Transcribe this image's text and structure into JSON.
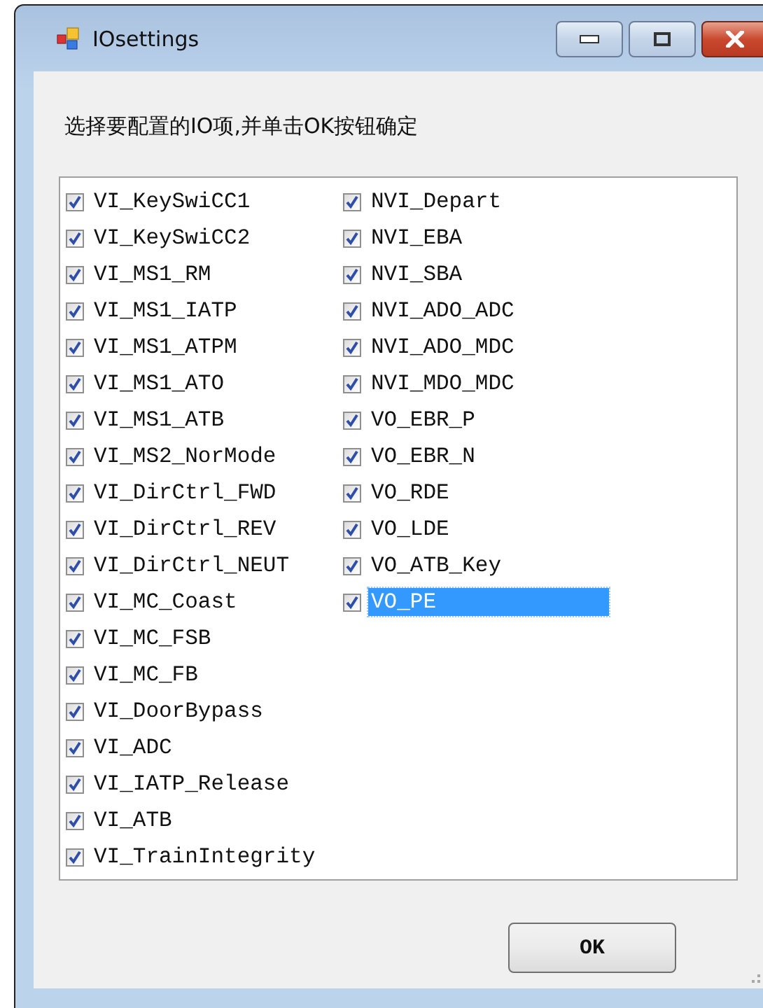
{
  "window": {
    "title": "IOsettings"
  },
  "instruction": "选择要配置的IO项,并单击OK按钮确定",
  "items": [
    {
      "label": "VI_KeySwiCC1",
      "checked": true,
      "selected": false
    },
    {
      "label": "VI_KeySwiCC2",
      "checked": true,
      "selected": false
    },
    {
      "label": "VI_MS1_RM",
      "checked": true,
      "selected": false
    },
    {
      "label": "VI_MS1_IATP",
      "checked": true,
      "selected": false
    },
    {
      "label": "VI_MS1_ATPM",
      "checked": true,
      "selected": false
    },
    {
      "label": "VI_MS1_ATO",
      "checked": true,
      "selected": false
    },
    {
      "label": "VI_MS1_ATB",
      "checked": true,
      "selected": false
    },
    {
      "label": "VI_MS2_NorMode",
      "checked": true,
      "selected": false
    },
    {
      "label": "VI_DirCtrl_FWD",
      "checked": true,
      "selected": false
    },
    {
      "label": "VI_DirCtrl_REV",
      "checked": true,
      "selected": false
    },
    {
      "label": "VI_DirCtrl_NEUT",
      "checked": true,
      "selected": false
    },
    {
      "label": "VI_MC_Coast",
      "checked": true,
      "selected": false
    },
    {
      "label": "VI_MC_FSB",
      "checked": true,
      "selected": false
    },
    {
      "label": "VI_MC_FB",
      "checked": true,
      "selected": false
    },
    {
      "label": "VI_DoorBypass",
      "checked": true,
      "selected": false
    },
    {
      "label": "VI_ADC",
      "checked": true,
      "selected": false
    },
    {
      "label": "VI_IATP_Release",
      "checked": true,
      "selected": false
    },
    {
      "label": "VI_ATB",
      "checked": true,
      "selected": false
    },
    {
      "label": "VI_TrainIntegrity",
      "checked": true,
      "selected": false
    },
    {
      "label": "NVI_Depart",
      "checked": true,
      "selected": false
    },
    {
      "label": "NVI_EBA",
      "checked": true,
      "selected": false
    },
    {
      "label": "NVI_SBA",
      "checked": true,
      "selected": false
    },
    {
      "label": "NVI_ADO_ADC",
      "checked": true,
      "selected": false
    },
    {
      "label": "NVI_ADO_MDC",
      "checked": true,
      "selected": false
    },
    {
      "label": "NVI_MDO_MDC",
      "checked": true,
      "selected": false
    },
    {
      "label": "VO_EBR_P",
      "checked": true,
      "selected": false
    },
    {
      "label": "VO_EBR_N",
      "checked": true,
      "selected": false
    },
    {
      "label": "VO_RDE",
      "checked": true,
      "selected": false
    },
    {
      "label": "VO_LDE",
      "checked": true,
      "selected": false
    },
    {
      "label": "VO_ATB_Key",
      "checked": true,
      "selected": false
    },
    {
      "label": "VO_PE",
      "checked": true,
      "selected": true
    }
  ],
  "buttons": [
    "OK"
  ]
}
